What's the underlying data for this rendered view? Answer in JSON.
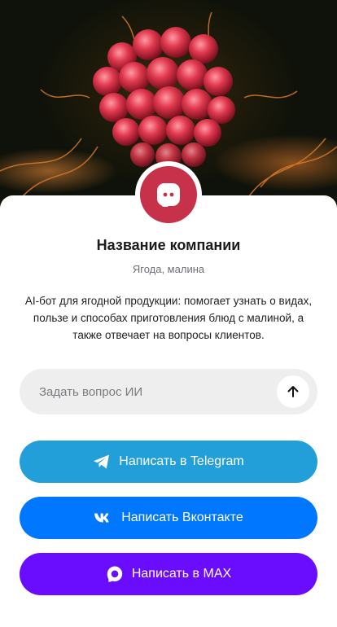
{
  "company": {
    "name": "Название компании",
    "category": "Ягода, малина",
    "description": "AI-бот для ягодной продукции: помогает узнать о видах, пользе и способах приготовления блюд с малиной, а также отвечает на вопросы клиентов."
  },
  "ask": {
    "placeholder": "Задать вопрос ИИ",
    "send_icon": "arrow-up-icon"
  },
  "buttons": [
    {
      "label": "Написать в Telegram",
      "icon": "telegram-icon",
      "color": "#229ed9"
    },
    {
      "label": "Написать Вконтакте",
      "icon": "vk-icon",
      "color": "#0077ff"
    },
    {
      "label": "Написать в MAX",
      "icon": "max-icon",
      "color": "#6a0dff"
    }
  ],
  "colors": {
    "avatar": "#c8314a",
    "ask_background": "#eeeeef"
  }
}
